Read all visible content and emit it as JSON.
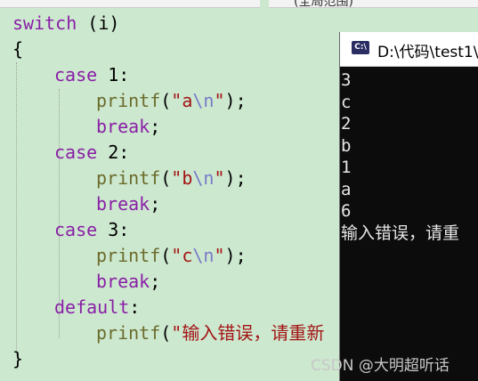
{
  "window_tabs": {
    "right_tab_text": "(全局范围)"
  },
  "code": {
    "l1": {
      "kw": "switch",
      "rest": " (i)"
    },
    "l2": "{",
    "l3": {
      "kw": "case",
      "rest": " 1:"
    },
    "l4": {
      "fn": "printf",
      "open": "(",
      "s1": "\"a",
      "esc": "\\n",
      "s2": "\"",
      "close": ");"
    },
    "l5": {
      "kw": "break",
      "rest": ";"
    },
    "l6": {
      "kw": "case",
      "rest": " 2:"
    },
    "l7": {
      "fn": "printf",
      "open": "(",
      "s1": "\"b",
      "esc": "\\n",
      "s2": "\"",
      "close": ");"
    },
    "l8": {
      "kw": "break",
      "rest": ";"
    },
    "l9": {
      "kw": "case",
      "rest": " 3:"
    },
    "l10": {
      "fn": "printf",
      "open": "(",
      "s1": "\"c",
      "esc": "\\n",
      "s2": "\"",
      "close": ");"
    },
    "l11": {
      "kw": "break",
      "rest": ";"
    },
    "l12": {
      "kw": "default",
      "rest": ":"
    },
    "l13": {
      "fn": "printf",
      "open": "(",
      "s1": "\"输入错误，请重新"
    },
    "l14": "}"
  },
  "console": {
    "title": "D:\\代码\\test1\\",
    "icon_label": "C:\\",
    "lines": [
      "3",
      "c",
      "2",
      "b",
      "1",
      "a",
      "6",
      "输入错误，请重"
    ]
  },
  "watermark": "CSDN @大明超听话"
}
